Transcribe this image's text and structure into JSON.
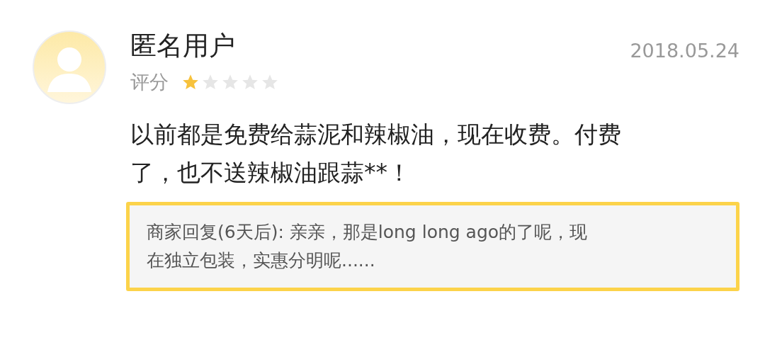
{
  "review": {
    "user": "匿名用户",
    "date": "2018.05.24",
    "rating_label": "评分",
    "rating": {
      "stars": 1
    },
    "text": "以前都是免费给蒜泥和辣椒油，现在收费。付费了，也不送辣椒油跟蒜**！",
    "reply": "商家回复(6天后): 亲亲，那是long long ago的了呢，现在独立包装，实惠分明呢......"
  }
}
